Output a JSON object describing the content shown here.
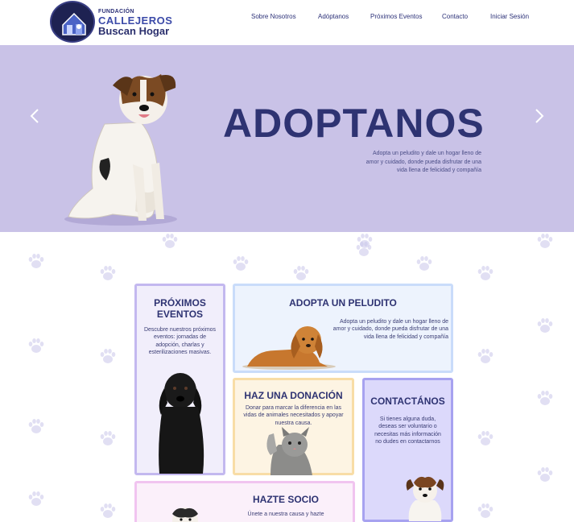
{
  "brand": {
    "line1": "FUNDACIÓN",
    "line2": "CALLEJEROS",
    "line3": "Buscan Hogar"
  },
  "nav": {
    "items": [
      "Sobre Nosotros",
      "Adóptanos",
      "Próximos Eventos",
      "Contacto",
      "Iniciar Sesión"
    ]
  },
  "hero": {
    "title": "ADOPTANOS",
    "description": "Adopta un peludito y dale un hogar lleno de amor y cuidado, donde pueda disfrutar de una vida llena de felicidad y compañía",
    "prev_icon": "chevron-left-icon",
    "next_icon": "chevron-right-icon"
  },
  "cards": {
    "eventos": {
      "title": "PRÓXIMOS EVENTOS",
      "text": "Descubre nuestros próximos eventos: jornadas de adopción, charlas y esterilizaciones masivas."
    },
    "adopta": {
      "title": "ADOPTA UN PELUDITO",
      "text": "Adopta un peludito y dale un hogar lleno de amor y cuidado, donde pueda disfrutar de una vida llena de felicidad y compañía"
    },
    "donacion": {
      "title": "HAZ UNA DONACIÓN",
      "text": "Donar para marcar la diferencia en las vidas de animales necesitados y apoyar nuestra causa."
    },
    "contacto": {
      "title": "CONTACTÁNOS",
      "text": "Si tienes alguna duda, deseas ser voluntario o necesitas más información no dudes en contactarnos"
    },
    "socio": {
      "title": "HAZTE SOCIO",
      "text": "Únete a nuestra causa y hazte"
    }
  },
  "colors": {
    "hero_bg": "#c9c2e7",
    "navy": "#2e3372",
    "card_purple_border": "#c3b8ef",
    "card_blue_border": "#c9dcfa",
    "card_yellow_border": "#f8dda6",
    "card_violet_border": "#a7a2f0",
    "card_pink_border": "#f1c4f0"
  }
}
